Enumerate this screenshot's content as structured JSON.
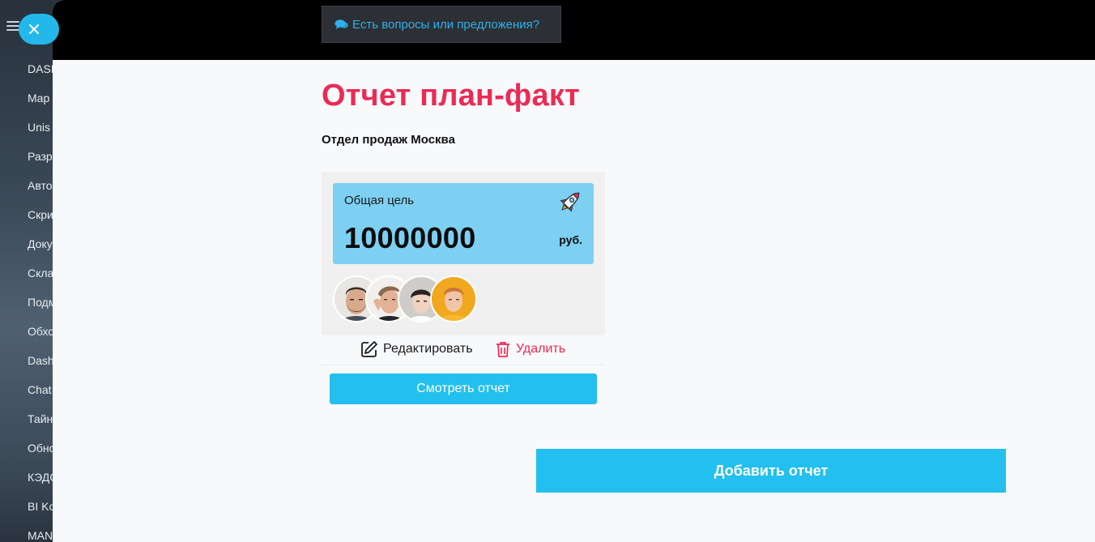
{
  "background_sidebar": {
    "items": [
      "DASI",
      "Map",
      "Unis",
      "Разр",
      "Авто",
      "Скри",
      "Доку",
      "Скла",
      "Подм",
      "Обхо",
      "Dash",
      "Chat",
      "Тайн",
      "Обнс",
      "КЭДС",
      "BI Ko",
      "MAN"
    ]
  },
  "header": {
    "feedback_label": "Есть вопросы или предложения?",
    "feedback_icon": "comments-icon"
  },
  "page": {
    "title": "Отчет план-факт",
    "department": "Отдел продаж Москва"
  },
  "report_card": {
    "goal_label": "Общая цель",
    "goal_value": "10000000",
    "goal_unit": "руб.",
    "goal_icon": "rocket-icon",
    "participants_count": 4,
    "edit_label": "Редактировать",
    "delete_label": "Удалить",
    "view_button": "Смотреть отчет"
  },
  "add_button": "Добавить отчет",
  "colors": {
    "accent": "#23bfee",
    "title": "#ec2a55",
    "goal_card": "#7dd0f2",
    "delete": "#ec2a55",
    "top_bar": "#000000"
  }
}
